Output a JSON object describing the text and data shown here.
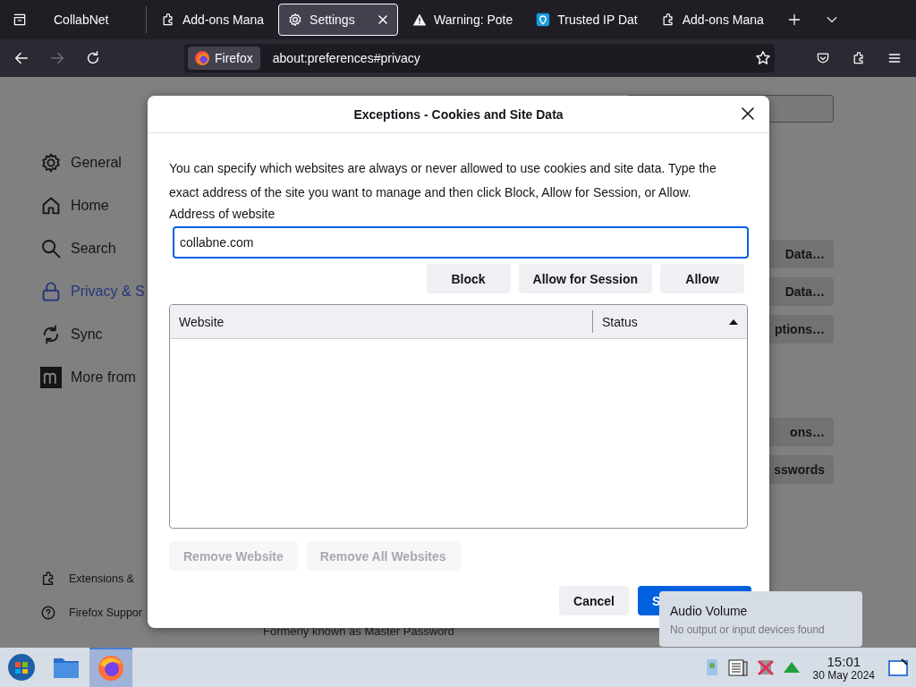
{
  "tabs": [
    {
      "label": "CollabNet",
      "kind": "plain",
      "selected": false
    },
    {
      "label": "Add-ons Mana",
      "kind": "addon",
      "selected": false
    },
    {
      "label": "Settings",
      "kind": "gear",
      "selected": true
    },
    {
      "label": "Warning: Pote",
      "kind": "warning",
      "selected": false
    },
    {
      "label": "Trusted IP Dat",
      "kind": "pin",
      "selected": false
    },
    {
      "label": "Add-ons Mana",
      "kind": "addon",
      "selected": false
    }
  ],
  "nav_buttons": [
    {
      "kind": "back",
      "disabled": false
    },
    {
      "kind": "forward",
      "disabled": true
    },
    {
      "kind": "reload",
      "disabled": false
    }
  ],
  "address_bar": {
    "identity": "Firefox",
    "url": "about:preferences#privacy"
  },
  "sidebar": {
    "items": [
      {
        "label": "General",
        "kind": "gear",
        "selected": false
      },
      {
        "label": "Home",
        "kind": "home",
        "selected": false
      },
      {
        "label": "Search",
        "kind": "search",
        "selected": false
      },
      {
        "label": "Privacy & S",
        "kind": "lock",
        "selected": true
      },
      {
        "label": "Sync",
        "kind": "sync",
        "selected": false
      },
      {
        "label": "More from",
        "kind": "mozilla",
        "selected": false
      }
    ],
    "footer_items": [
      {
        "label": "Extensions &",
        "kind": "addon"
      },
      {
        "label": "Firefox Suppor",
        "kind": "help"
      }
    ]
  },
  "page_buttons": [
    "Data…",
    "Data…",
    "ptions…",
    "ons…",
    "sswords"
  ],
  "page_note": "Formerly known as Master Password",
  "dialog": {
    "title": "Exceptions - Cookies and Site Data",
    "description": "You can specify which websites are always or never allowed to use cookies and site data. Type the exact address of the site you want to manage and then click Block, Allow for Session, or Allow.",
    "address_label": "Address of website",
    "address_value": "collabne.com",
    "add_buttons": [
      "Block",
      "Allow for Session",
      "Allow"
    ],
    "table": {
      "columns": [
        {
          "label": "Website",
          "sorted": false
        },
        {
          "label": "Status",
          "sorted": true
        }
      ]
    },
    "remove_buttons": [
      {
        "label": "Remove Website",
        "disabled": true
      },
      {
        "label": "Remove All Websites",
        "disabled": true
      }
    ],
    "footer_buttons": [
      {
        "label": "Cancel",
        "kind": "secondary"
      },
      {
        "label": "S",
        "kind": "primary"
      }
    ]
  },
  "taskbar": {
    "apps": [
      {
        "kind": "start",
        "selected": false
      },
      {
        "kind": "folder",
        "selected": false
      },
      {
        "kind": "firefox",
        "selected": true
      }
    ],
    "clock": {
      "time": "15:01",
      "date": "30 May 2024"
    }
  },
  "tooltip": {
    "title": "Audio Volume",
    "text": "No output or input devices found"
  }
}
